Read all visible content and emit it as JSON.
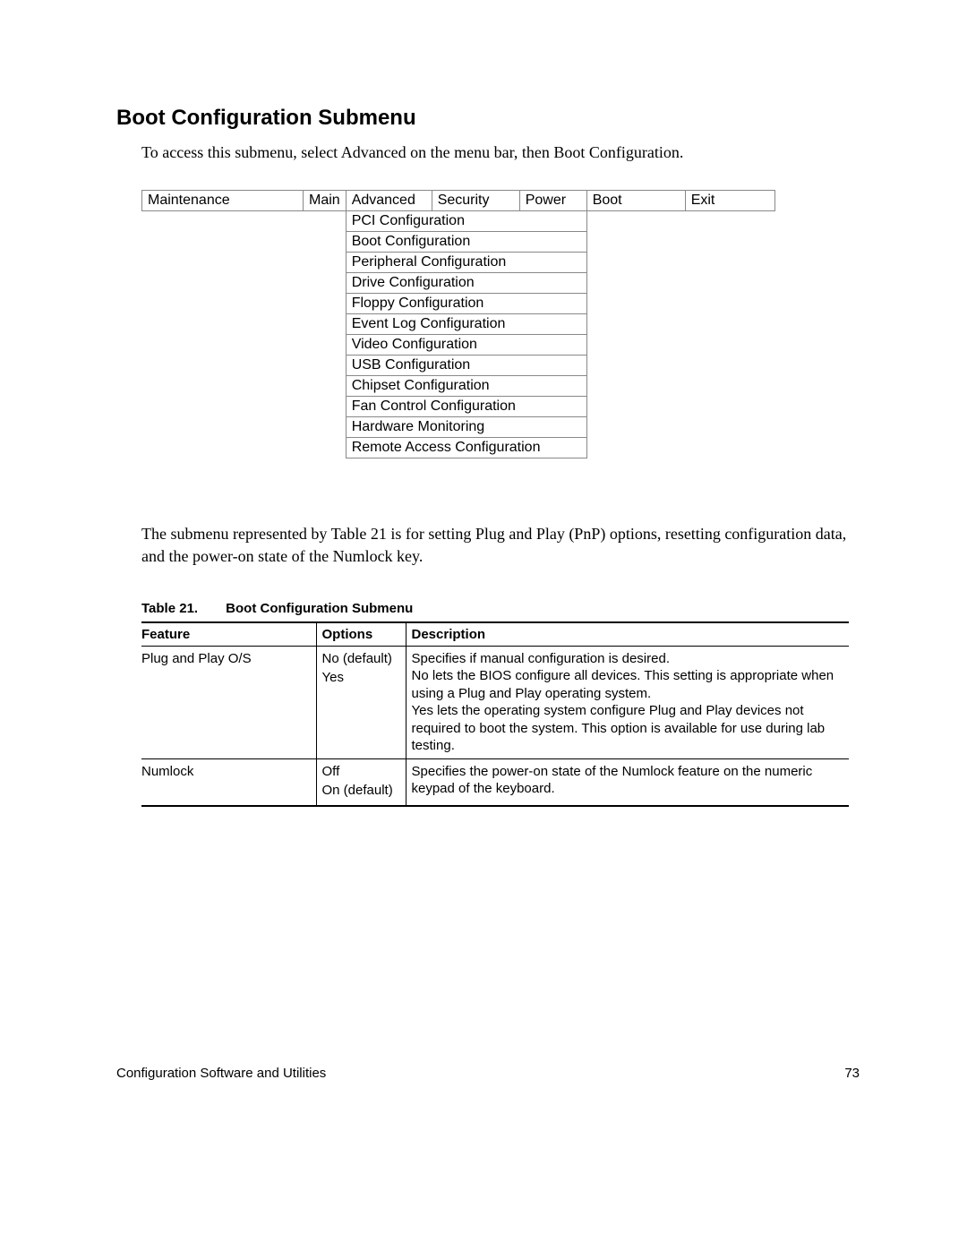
{
  "heading": "Boot Configuration Submenu",
  "intro": "To access this submenu, select Advanced on the menu bar, then Boot Configuration.",
  "menubar": [
    "Maintenance",
    "Main",
    "Advanced",
    "Security",
    "Power",
    "Boot",
    "Exit"
  ],
  "submenu_items": [
    "PCI Configuration",
    " Boot Configuration",
    "Peripheral Configuration",
    "Drive Configuration",
    "Floppy Configuration",
    "Event Log Configuration",
    "Video Configuration",
    "USB Configuration",
    "Chipset Configuration",
    "Fan Control Configuration",
    "Hardware Monitoring",
    "Remote Access Configuration"
  ],
  "body2": "The submenu represented by Table 21 is for setting Plug and Play (PnP) options, resetting configuration data, and the power-on state of the Numlock key.",
  "caption": {
    "label": "Table 21.",
    "title": "Boot Configuration Submenu"
  },
  "feat_table": {
    "headers": [
      "Feature",
      "Options",
      "Description"
    ],
    "rows": [
      {
        "feature": "Plug and Play O/S",
        "options": [
          "No (default)",
          "Yes"
        ],
        "description": "Specifies if manual configuration is desired.\nNo lets the BIOS configure all devices. This setting is appropriate when using a Plug and Play operating system.\nYes lets the operating system configure Plug and Play devices not required to boot the system. This option is available for use during lab testing."
      },
      {
        "feature": "Numlock",
        "options": [
          "Off",
          "On (default)"
        ],
        "description": "Specifies the power-on state of the Numlock feature on the numeric keypad of the keyboard."
      }
    ]
  },
  "footer": {
    "left": "Configuration Software and Utilities",
    "right": "73"
  }
}
